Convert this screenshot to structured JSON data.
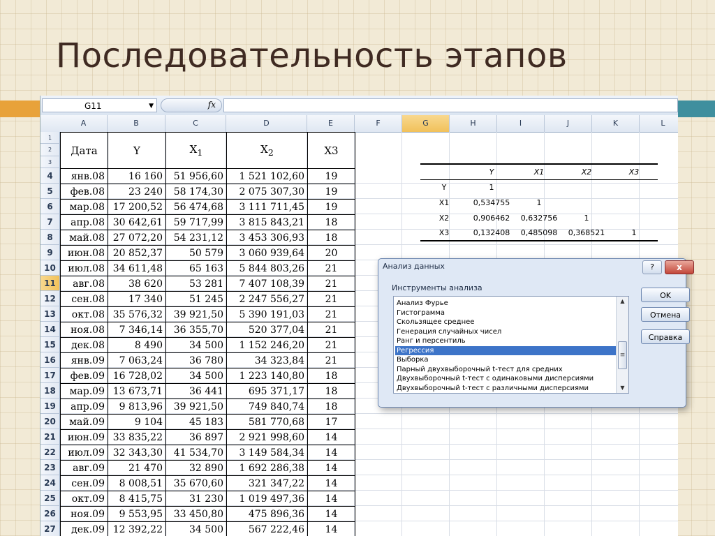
{
  "slide": {
    "title": "Последовательность этапов"
  },
  "formula_bar": {
    "name_box": "G11",
    "fx": "fx",
    "formula": ""
  },
  "columns": [
    "A",
    "B",
    "C",
    "D",
    "E",
    "F",
    "G",
    "H",
    "I",
    "J",
    "K",
    "L"
  ],
  "selected_column": "G",
  "rows": [
    "1",
    "2",
    "3",
    "4",
    "5",
    "6",
    "7",
    "8",
    "9",
    "10",
    "11",
    "12",
    "13",
    "14",
    "15",
    "16",
    "17",
    "18",
    "19",
    "20",
    "21",
    "22",
    "23",
    "24",
    "25",
    "26",
    "27"
  ],
  "selected_row": "11",
  "table": {
    "headers": [
      "Дата",
      "Y",
      "X1",
      "X2",
      "X3"
    ],
    "rows": [
      [
        "янв.08",
        "16 160",
        "51 956,60",
        "1 521 102,60",
        "19"
      ],
      [
        "фев.08",
        "23 240",
        "58 174,30",
        "2 075 307,30",
        "19"
      ],
      [
        "мар.08",
        "17 200,52",
        "56 474,68",
        "3 111 711,45",
        "19"
      ],
      [
        "апр.08",
        "30 642,61",
        "59 717,99",
        "3 815 843,21",
        "18"
      ],
      [
        "май.08",
        "27 072,20",
        "54 231,12",
        "3 453 306,93",
        "18"
      ],
      [
        "июн.08",
        "20 852,37",
        "50 579",
        "3 060 939,64",
        "20"
      ],
      [
        "июл.08",
        "34 611,48",
        "65 163",
        "5 844 803,26",
        "21"
      ],
      [
        "авг.08",
        "38 620",
        "53 281",
        "7 407 108,39",
        "21"
      ],
      [
        "сен.08",
        "17 340",
        "51 245",
        "2 247 556,27",
        "21"
      ],
      [
        "окт.08",
        "35 576,32",
        "39 921,50",
        "5 390 191,03",
        "21"
      ],
      [
        "ноя.08",
        "7 346,14",
        "36 355,70",
        "520 377,04",
        "21"
      ],
      [
        "дек.08",
        "8 490",
        "34 500",
        "1 152 246,20",
        "21"
      ],
      [
        "янв.09",
        "7 063,24",
        "36 780",
        "34 323,84",
        "21"
      ],
      [
        "фев.09",
        "16 728,02",
        "34 500",
        "1 223 140,80",
        "18"
      ],
      [
        "мар.09",
        "13 673,71",
        "36 441",
        "695 371,17",
        "18"
      ],
      [
        "апр.09",
        "9 813,96",
        "39 921,50",
        "749 840,74",
        "18"
      ],
      [
        "май.09",
        "9 104",
        "45 183",
        "581 770,68",
        "17"
      ],
      [
        "июн.09",
        "33 835,22",
        "36 897",
        "2 921 998,60",
        "14"
      ],
      [
        "июл.09",
        "32 343,30",
        "41 534,70",
        "3 149 584,34",
        "14"
      ],
      [
        "авг.09",
        "21 470",
        "32 890",
        "1 692 286,38",
        "14"
      ],
      [
        "сен.09",
        "8 008,51",
        "35 670,60",
        "321 347,22",
        "14"
      ],
      [
        "окт.09",
        "8 415,75",
        "31 230",
        "1 019 497,36",
        "14"
      ],
      [
        "ноя.09",
        "9 553,95",
        "33 450,80",
        "475 896,36",
        "14"
      ],
      [
        "дек.09",
        "12 392,22",
        "34 500",
        "567 222,46",
        "14"
      ]
    ]
  },
  "correlation": {
    "headers": [
      "",
      "Y",
      "X1",
      "X2",
      "X3"
    ],
    "rows": [
      [
        "Y",
        "1",
        "",
        "",
        ""
      ],
      [
        "X1",
        "0,534755",
        "1",
        "",
        ""
      ],
      [
        "X2",
        "0,906462",
        "0,632756",
        "1",
        ""
      ],
      [
        "X3",
        "0,132408",
        "0,485098",
        "0,368521",
        "1"
      ]
    ]
  },
  "dialog": {
    "title": "Анализ данных",
    "help": "?",
    "close": "x",
    "group_label": "Инструменты анализа",
    "tools": [
      "Анализ Фурье",
      "Гистограмма",
      "Скользящее среднее",
      "Генерация случайных чисел",
      "Ранг и персентиль",
      "Регрессия",
      "Выборка",
      "Парный двухвыборочный t-тест для средних",
      "Двухвыборочный t-тест с одинаковыми дисперсиями",
      "Двухвыборочный t-тест с различными дисперсиями"
    ],
    "selected_tool": "Регрессия",
    "ok": "OK",
    "cancel": "Отмена",
    "help_button": "Справка"
  }
}
